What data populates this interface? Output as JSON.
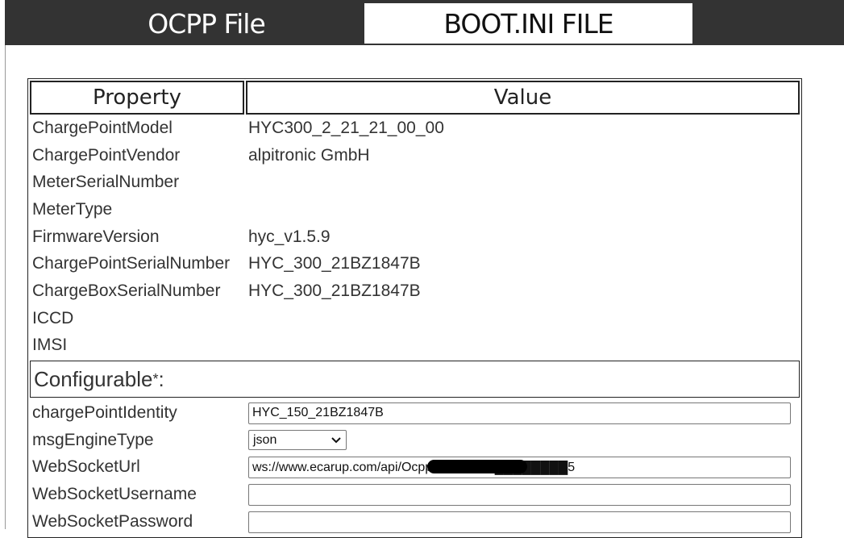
{
  "tabs": [
    {
      "label": "OCPP File",
      "active": false
    },
    {
      "label": "BOOT.INI FILE",
      "active": true
    }
  ],
  "table": {
    "headers": {
      "property": "Property",
      "value": "Value"
    },
    "rows": [
      {
        "property": "ChargePointModel",
        "value": "HYC300_2_21_21_00_00"
      },
      {
        "property": "ChargePointVendor",
        "value": "alpitronic GmbH"
      },
      {
        "property": "MeterSerialNumber",
        "value": ""
      },
      {
        "property": "MeterType",
        "value": ""
      },
      {
        "property": "FirmwareVersion",
        "value": "hyc_v1.5.9"
      },
      {
        "property": "ChargePointSerialNumber",
        "value": "HYC_300_21BZ1847B"
      },
      {
        "property": "ChargeBoxSerialNumber",
        "value": "HYC_300_21BZ1847B"
      },
      {
        "property": "ICCD",
        "value": ""
      },
      {
        "property": "IMSI",
        "value": ""
      }
    ],
    "configurable": {
      "label": "Configurable",
      "asterisk": "*",
      "suffix": ":"
    },
    "config_rows": [
      {
        "property": "chargePointIdentity",
        "value": "HYC_150_21BZ1847B"
      },
      {
        "property": "msgEngineType",
        "value": "json"
      },
      {
        "property": "WebSocketUrl",
        "value": "ws://www.ecarup.com/api/Ocpp16/8282E8████████5"
      },
      {
        "property": "WebSocketUsername",
        "value": ""
      },
      {
        "property": "WebSocketPassword",
        "value": ""
      }
    ]
  }
}
